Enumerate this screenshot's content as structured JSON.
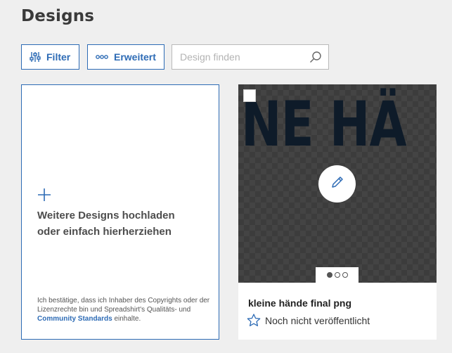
{
  "page": {
    "title": "Designs"
  },
  "toolbar": {
    "filter_label": "Filter",
    "advanced_label": "Erweitert",
    "search_placeholder": "Design finden",
    "search_value": ""
  },
  "upload": {
    "title_line1": "Weitere Designs hochladen",
    "title_line2": "oder einfach hierherziehen",
    "legal_text": "Ich bestätige, dass ich Inhaber des Copyrights oder der Lizenzrechte bin und Spreadshirt's Qualitäts- und ",
    "legal_link": "Community Standards",
    "legal_suffix": " einhalte."
  },
  "design": {
    "preview_text": "NE HÄ",
    "name": "kleine hände final png",
    "status": "Noch nicht veröffentlicht",
    "carousel": {
      "total": 3,
      "active": 1
    }
  },
  "colors": {
    "accent": "#2d6bb5",
    "background": "#efefef",
    "preview_text": "#0e1b29"
  },
  "icons": {
    "filter": "sliders-icon",
    "advanced": "three-dots-icon",
    "search": "search-icon",
    "upload": "plus-icon",
    "edit": "pencil-icon",
    "status": "star-outline-icon"
  }
}
